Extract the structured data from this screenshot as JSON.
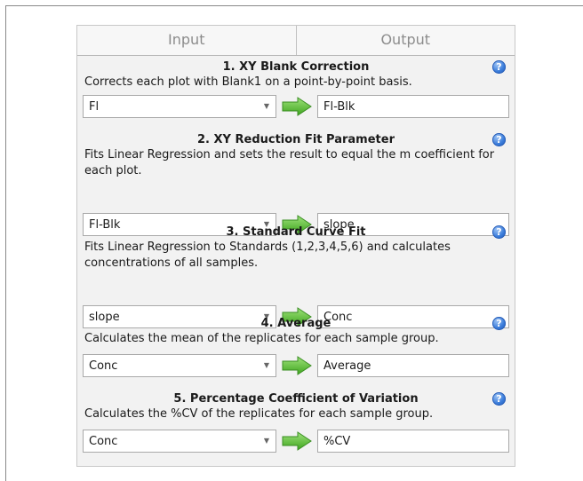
{
  "tabs": {
    "input": "Input",
    "output": "Output"
  },
  "steps": [
    {
      "title": "1. XY Blank Correction",
      "desc": "Corrects each plot with Blank1 on a point-by-point basis.",
      "input": "Fl",
      "output": "Fl-Blk"
    },
    {
      "title": "2. XY Reduction Fit Parameter",
      "desc": "Fits Linear Regression and sets the result to equal the m coefficient for each plot.",
      "input": "Fl-Blk",
      "output": "slope"
    },
    {
      "title": "3. Standard Curve Fit",
      "desc": "Fits Linear Regression to Standards (1,2,3,4,5,6) and calculates concentrations of all samples.",
      "input": "slope",
      "output": "Conc"
    },
    {
      "title": "4. Average",
      "desc": "Calculates the mean of the replicates for each sample group.",
      "input": "Conc",
      "output": "Average"
    },
    {
      "title": "5. Percentage Coefficient of Variation",
      "desc": "Calculates the %CV of the replicates for each sample group.",
      "input": "Conc",
      "output": "%CV"
    }
  ],
  "icons": {
    "help": "help-icon",
    "arrow": "arrow-right-icon",
    "dropdown": "chevron-down-icon"
  },
  "colors": {
    "arrow_green": "#5cc23a",
    "help_blue": "#3b7ddb"
  }
}
